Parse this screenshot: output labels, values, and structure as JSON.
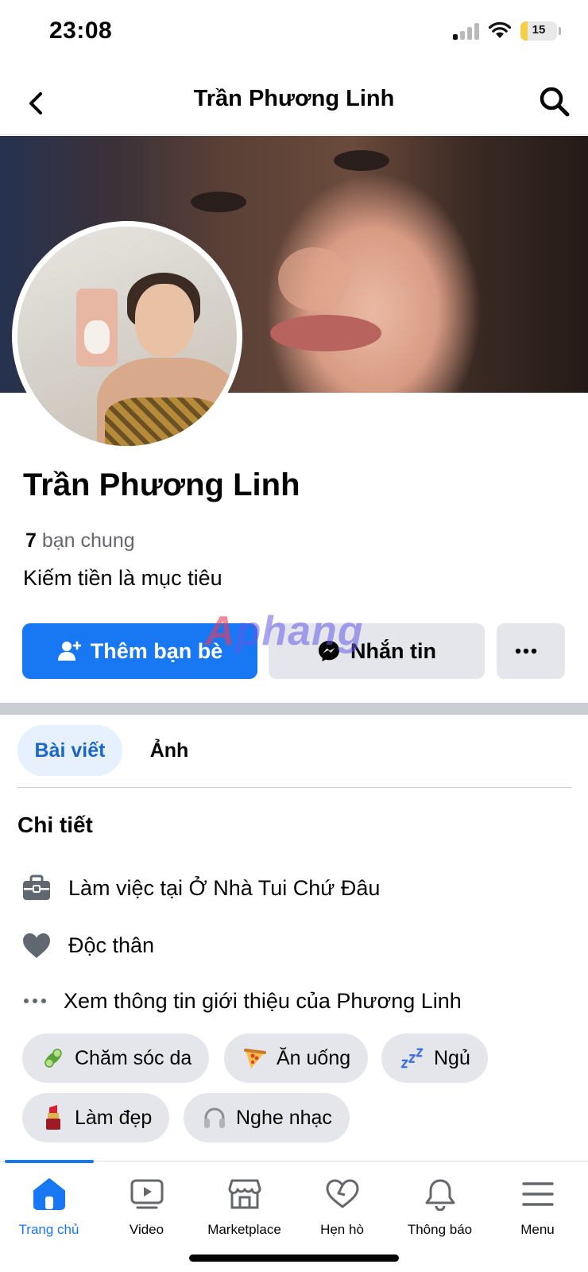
{
  "status_bar": {
    "time": "23:08",
    "battery": "15"
  },
  "header": {
    "title": "Trần Phương Linh"
  },
  "profile": {
    "name": "Trần Phương Linh",
    "mutual_count": "7",
    "mutual_label": "bạn chung",
    "bio": "Kiếm tiền là mục tiêu"
  },
  "actions": {
    "add_friend": "Thêm bạn bè",
    "message": "Nhắn tin"
  },
  "watermark": {
    "first": "A",
    "rest": "phang"
  },
  "tabs": [
    {
      "label": "Bài viết",
      "active": true
    },
    {
      "label": "Ảnh",
      "active": false
    }
  ],
  "details": {
    "title": "Chi tiết",
    "items": [
      {
        "icon": "briefcase-icon",
        "text": "Làm việc tại Ở Nhà Tui Chứ Đâu"
      },
      {
        "icon": "heart-icon",
        "text": "Độc thân"
      },
      {
        "icon": "more-dots-icon",
        "text": "Xem thông tin giới thiệu của Phương Linh"
      }
    ]
  },
  "interests": [
    {
      "icon": "cucumber-icon",
      "label": "Chăm sóc da"
    },
    {
      "icon": "pizza-icon",
      "label": "Ăn uống"
    },
    {
      "icon": "sleep-icon",
      "label": "Ngủ"
    },
    {
      "icon": "lipstick-icon",
      "label": "Làm đẹp"
    },
    {
      "icon": "headphones-icon",
      "label": "Nghe nhạc"
    }
  ],
  "bottom_nav": [
    {
      "icon": "home-icon",
      "label": "Trang chủ",
      "active": true
    },
    {
      "icon": "video-icon",
      "label": "Video",
      "active": false
    },
    {
      "icon": "marketplace-icon",
      "label": "Marketplace",
      "active": false
    },
    {
      "icon": "dating-icon",
      "label": "Hẹn hò",
      "active": false
    },
    {
      "icon": "bell-icon",
      "label": "Thông báo",
      "active": false
    },
    {
      "icon": "menu-icon",
      "label": "Menu",
      "active": false
    }
  ],
  "colors": {
    "accent": "#1877f2",
    "tab_active_bg": "#e7f0fd",
    "chip_bg": "#e4e6eb"
  }
}
